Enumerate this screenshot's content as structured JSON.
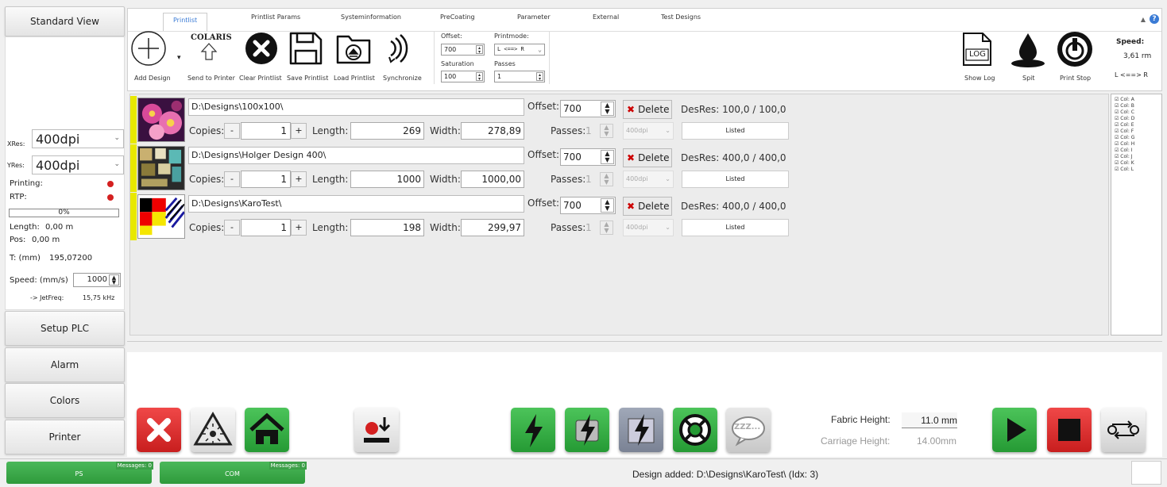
{
  "nav": {
    "standard_view": "Standard View",
    "setup_plc": "Setup PLC",
    "alarm": "Alarm",
    "colors": "Colors",
    "printer": "Printer"
  },
  "left": {
    "xres_label": "XRes:",
    "xres_value": "400dpi",
    "yres_label": "YRes:",
    "yres_value": "400dpi",
    "printing_label": "Printing:",
    "rtp_label": "RTP:",
    "progress": "0%",
    "progress_value": 0,
    "length_label": "Length:",
    "length_value": "0,00 m",
    "pos_label": "Pos:",
    "pos_value": "0,00 m",
    "t_label": "T: (mm)",
    "t_value": "195,07200",
    "speed_label": "Speed: (mm/s)",
    "speed_value": "1000",
    "jetfreq_label": "-> JetFreq:",
    "jetfreq_value": "15,75 kHz"
  },
  "tabs": [
    "Printlist",
    "Printlist Params",
    "Systeminformation",
    "PreCoating",
    "Parameter",
    "External",
    "Test Designs"
  ],
  "toolbar": {
    "add": "Add Design",
    "send": "Send to Printer",
    "send_logo": "COLARIS",
    "clear": "Clear Printlist",
    "save": "Save Printlist",
    "load": "Load Printlist",
    "sync": "Synchronize",
    "offset_label": "Offset:",
    "offset_value": "700",
    "printmode_label": "Printmode:",
    "printmode_value": "L <==> R",
    "saturation_label": "Saturation",
    "saturation_value": "100",
    "passes_label": "Passes",
    "passes_value": "1",
    "show_log": "Show Log",
    "log_icon_text": "LOG",
    "spit": "Spit",
    "print_stop": "Print Stop",
    "speed_label": "Speed:",
    "speed_value": "3,61 rm",
    "direction": "L <==> R"
  },
  "designs": [
    {
      "path": "D:\\Designs\\100x100\\",
      "copies": "1",
      "length": "269",
      "width": "278,89",
      "offset": "700",
      "passes": "1",
      "res": "400dpi",
      "desres": "DesRes: 100,0 / 100,0",
      "status": "Listed"
    },
    {
      "path": "D:\\Designs\\Holger Design 400\\",
      "copies": "1",
      "length": "1000",
      "width": "1000,00",
      "offset": "700",
      "passes": "1",
      "res": "400dpi",
      "desres": "DesRes: 400,0 / 400,0",
      "status": "Listed"
    },
    {
      "path": "D:\\Designs\\KaroTest\\",
      "copies": "1",
      "length": "198",
      "width": "299,97",
      "offset": "700",
      "passes": "1",
      "res": "400dpi",
      "desres": "DesRes: 400,0 / 400,0",
      "status": "Listed"
    }
  ],
  "labels": {
    "copies": "Copies:",
    "length": "Length:",
    "width": "Width:",
    "offset": "Offset:",
    "passes": "Passes:",
    "delete": "Delete",
    "minus": "-",
    "plus": "+"
  },
  "cols": [
    "Col: A",
    "Col: B",
    "Col: C",
    "Col: D",
    "Col: E",
    "Col: F",
    "Col: G",
    "Col: H",
    "Col: I",
    "Col: J",
    "Col: K",
    "Col: L"
  ],
  "bottom": {
    "fabric_label": "Fabric Height:",
    "fabric_value": "11.0 mm",
    "carriage_label": "Carriage Height:",
    "carriage_value": "14.00mm",
    "zzz": "ZZZ..."
  },
  "status": {
    "ps": "PS",
    "com": "COM",
    "messages_ps": "Messages: 0",
    "messages_com": "Messages: 0",
    "message": "Design added: D:\\Designs\\KaroTest\\ (Idx: 3)"
  }
}
